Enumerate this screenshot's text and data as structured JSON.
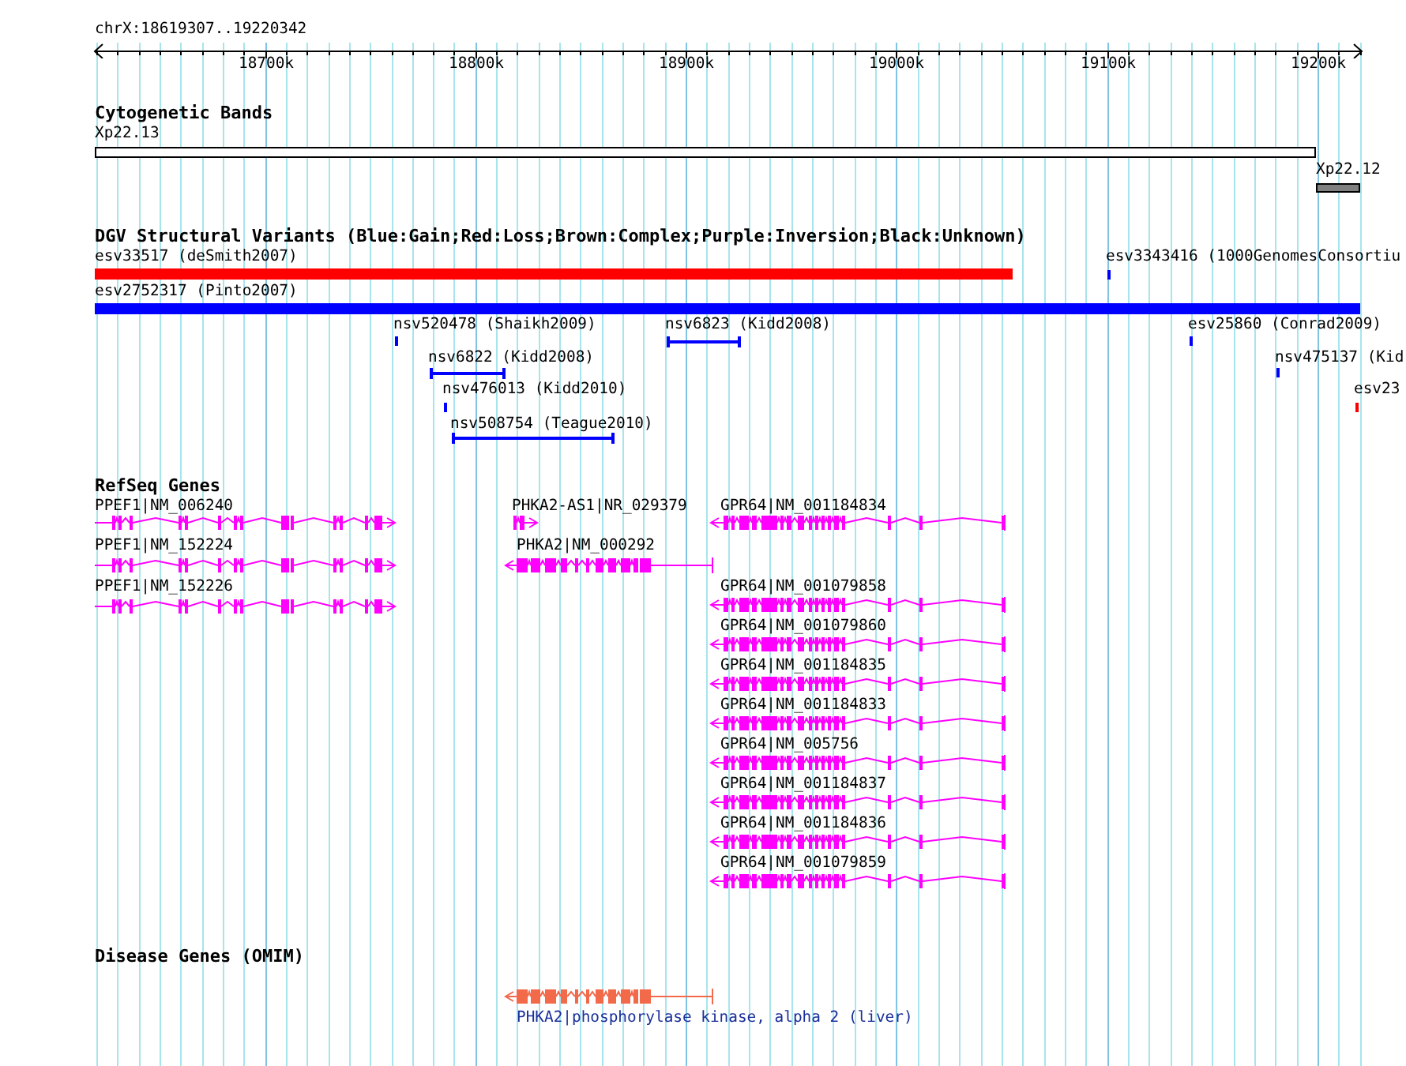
{
  "ruler": {
    "range": "chrX:18619307..19220342",
    "ticks": [
      "18700k",
      "18800k",
      "18900k",
      "19000k",
      "19100k",
      "19200k"
    ]
  },
  "cytogenetic_bands": {
    "title": "Cytogenetic Bands",
    "bands": [
      {
        "label": "Xp22.13",
        "color": "#ffffff"
      },
      {
        "label": "Xp22.12",
        "color": "#808080"
      }
    ]
  },
  "dgv_variants": {
    "title": "DGV Structural Variants (Blue:Gain;Red:Loss;Brown:Complex;Purple:Inversion;Black:Unknown)",
    "variants": [
      {
        "label": "esv33517 (deSmith2007)",
        "color": "#ff0000"
      },
      {
        "label": "esv3343416 (1000GenomesConsortiu",
        "color": "#0000ff"
      },
      {
        "label": "esv2752317 (Pinto2007)",
        "color": "#0000ff"
      },
      {
        "label": "nsv520478 (Shaikh2009)",
        "color": "#0000ff"
      },
      {
        "label": "nsv6823 (Kidd2008)",
        "color": "#0000ff"
      },
      {
        "label": "esv25860 (Conrad2009)",
        "color": "#0000ff"
      },
      {
        "label": "nsv6822 (Kidd2008)",
        "color": "#0000ff"
      },
      {
        "label": "nsv475137 (Kid",
        "color": "#0000ff"
      },
      {
        "label": "nsv476013 (Kidd2010)",
        "color": "#0000ff"
      },
      {
        "label": "esv23",
        "color": "#ff0000"
      },
      {
        "label": "nsv508754 (Teague2010)",
        "color": "#0000ff"
      }
    ]
  },
  "refseq_genes": {
    "title": "RefSeq Genes",
    "genes": [
      {
        "label": "PPEF1|NM_006240",
        "reverse_strand": false
      },
      {
        "label": "PPEF1|NM_152224",
        "reverse_strand": false
      },
      {
        "label": "PPEF1|NM_152226",
        "reverse_strand": false
      },
      {
        "label": "PHKA2-AS1|NR_029379",
        "reverse_strand": false
      },
      {
        "label": "PHKA2|NM_000292",
        "reverse_strand": true
      },
      {
        "label": "GPR64|NM_001184834",
        "reverse_strand": true
      },
      {
        "label": "GPR64|NM_001079858",
        "reverse_strand": true
      },
      {
        "label": "GPR64|NM_001079860",
        "reverse_strand": true
      },
      {
        "label": "GPR64|NM_001184835",
        "reverse_strand": true
      },
      {
        "label": "GPR64|NM_001184833",
        "reverse_strand": true
      },
      {
        "label": "GPR64|NM_005756",
        "reverse_strand": true
      },
      {
        "label": "GPR64|NM_001184837",
        "reverse_strand": true
      },
      {
        "label": "GPR64|NM_001184836",
        "reverse_strand": true
      },
      {
        "label": "GPR64|NM_001079859",
        "reverse_strand": true
      }
    ]
  },
  "disease_genes": {
    "title": "Disease Genes (OMIM)",
    "genes": [
      {
        "label": "PHKA2|phosphorylase kinase, alpha 2 (liver)",
        "reverse_strand": true
      }
    ]
  }
}
